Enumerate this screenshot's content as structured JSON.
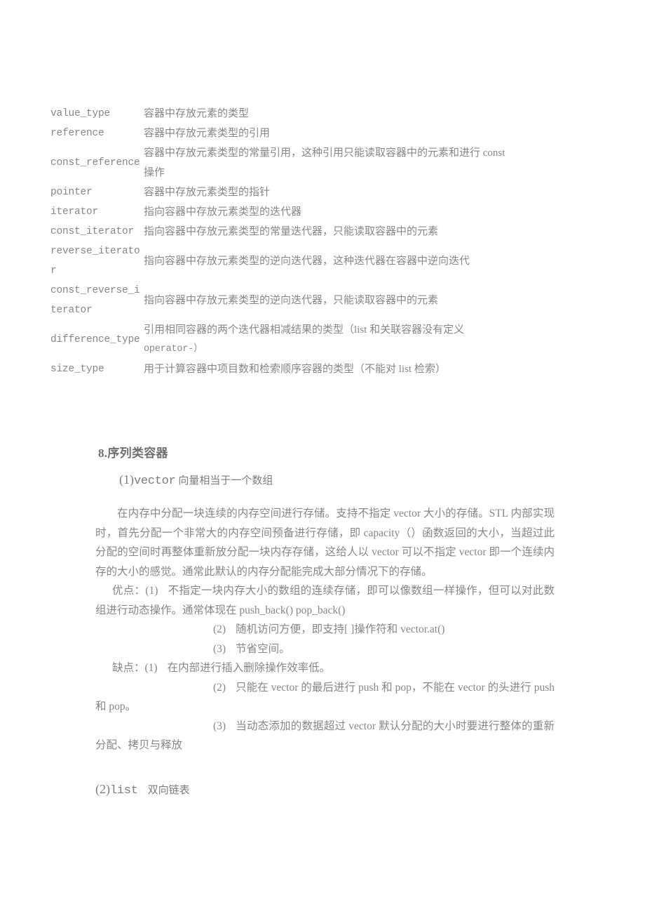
{
  "document": {
    "typedef_table": {
      "rows": [
        {
          "name": "value_type",
          "desc": "容器中存放元素的类型",
          "desc2": ""
        },
        {
          "name": "reference",
          "desc": "容器中存放元素类型的引用",
          "desc2": ""
        },
        {
          "name": "const_reference",
          "desc": "容器中存放元素类型的常量引用，这种引用只能读取容器中的元素和进行 const",
          "desc2": "操作"
        },
        {
          "name": "pointer",
          "desc": "容器中存放元素类型的指针",
          "desc2": ""
        },
        {
          "name": "iterator",
          "desc": "指向容器中存放元素类型的迭代器",
          "desc2": ""
        },
        {
          "name": "const_iterator",
          "desc": "指向容器中存放元素类型的常量迭代器，只能读取容器中的元素",
          "desc2": ""
        },
        {
          "name": "reverse_iterator",
          "desc": "指向容器中存放元素类型的逆向迭代器，这种迭代器在容器中逆向迭代",
          "desc2": ""
        },
        {
          "name": "const_reverse_iterator",
          "desc": "指向容器中存放元素类型的逆向迭代器，只能读取容器中的元素",
          "desc2": ""
        },
        {
          "name": "difference_type",
          "desc": "引用相同容器的两个迭代器相减结果的类型（list 和关联容器没有定义",
          "desc2": "operator-）"
        },
        {
          "name": "size_type",
          "desc": "用于计算容器中项目数和检索顺序容器的类型（不能对 list 检索）",
          "desc2": ""
        }
      ]
    },
    "section": {
      "heading": "8.序列类容器"
    },
    "vector": {
      "number": "(1)",
      "name": "vector",
      "subtitle": "向量相当于一个数组",
      "paragraph": "在内存中分配一块连续的内存空间进行存储。支持不指定 vector 大小的存储。STL 内部实现时，首先分配一个非常大的内存空间预备进行存储，即 capacity（）函数返回的大小，当超过此分配的空间时再整体重新放分配一块内存存储，这给人以 vector 可以不指定 vector 即一个连续内存的大小的感觉。通常此默认的内存分配能完成大部分情况下的存储。",
      "pros_label": "优点：",
      "pros": [
        {
          "num": "(1)",
          "text": "不指定一块内存大小的数组的连续存储，即可以像数组一样操作，但可以对此数组进行动态操作。通常体现在 push_back() pop_back()"
        },
        {
          "num": "(2)",
          "text": "随机访问方便，即支持[ ]操作符和 vector.at()"
        },
        {
          "num": "(3)",
          "text": "节省空间。"
        }
      ],
      "cons_label": "缺点：",
      "cons": [
        {
          "num": "(1)",
          "text": "在内部进行插入删除操作效率低。"
        },
        {
          "num": "(2)",
          "text": "只能在 vector 的最后进行 push 和 pop，不能在 vector 的头进行 push 和 pop。"
        },
        {
          "num": "(3)",
          "text": "当动态添加的数据超过 vector 默认分配的大小时要进行整体的重新分配、拷贝与释放"
        }
      ]
    },
    "list": {
      "number": "(2)",
      "name": "list",
      "subtitle": "双向链表"
    }
  }
}
